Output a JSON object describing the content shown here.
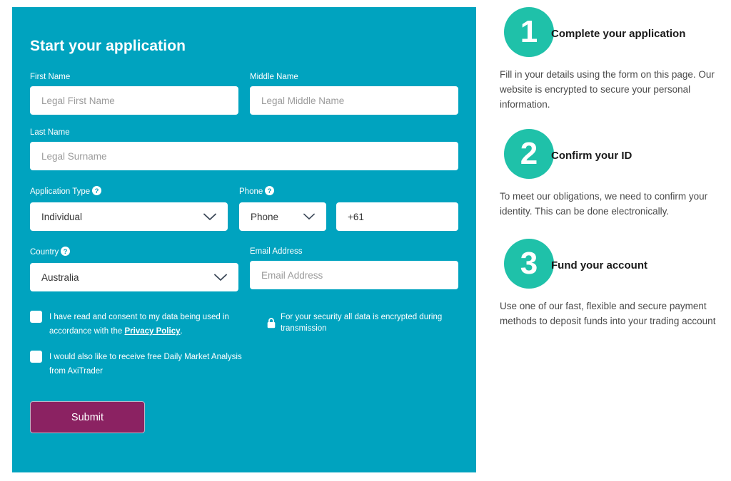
{
  "form": {
    "title": "Start your application",
    "fields": {
      "first_name": {
        "label": "First Name",
        "placeholder": "Legal First Name",
        "value": ""
      },
      "middle_name": {
        "label": "Middle Name",
        "placeholder": "Legal Middle Name",
        "value": ""
      },
      "last_name": {
        "label": "Last Name",
        "placeholder": "Legal Surname",
        "value": ""
      },
      "application_type": {
        "label": "Application Type",
        "selected": "Individual",
        "help": "?"
      },
      "phone": {
        "label": "Phone",
        "type_selected": "Phone",
        "number_value": "+61",
        "help": "?"
      },
      "country": {
        "label": "Country",
        "selected": "Australia",
        "help": "?"
      },
      "email": {
        "label": "Email Address",
        "placeholder": "Email Address",
        "value": ""
      }
    },
    "consent": {
      "checkbox_1_text_before": "I have read and consent to my data being used in accordance with the ",
      "checkbox_1_link": "Privacy Policy",
      "checkbox_1_text_after": ".",
      "checkbox_2_text": "I would also like to receive free Daily Market Analysis from AxiTrader",
      "security_note": "For your security all data is encrypted during transmission"
    },
    "submit_label": "Submit"
  },
  "steps": [
    {
      "number": "1",
      "title": "Complete your application",
      "body": "Fill in your details using the form on this page. Our website is encrypted to secure your personal information."
    },
    {
      "number": "2",
      "title": "Confirm your ID",
      "body": "To meet our obligations, we need to confirm your identity. This can be done electronically."
    },
    {
      "number": "3",
      "title": "Fund your account",
      "body": "Use one of our fast, flexible and secure payment methods to deposit funds into your trading account"
    }
  ],
  "colors": {
    "panel_teal": "#00a3bf",
    "step_circle": "#1fc1a9",
    "submit_magenta": "#8b2262",
    "input_white": "#ffffff"
  }
}
